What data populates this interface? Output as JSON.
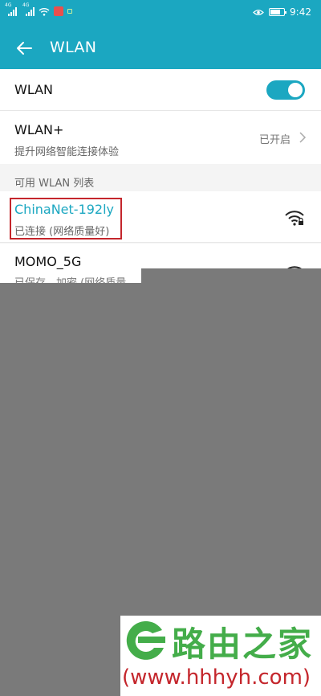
{
  "status_bar": {
    "signal1_label": "4G",
    "signal2_label": "4G",
    "time": "9:42"
  },
  "app_bar": {
    "title": "WLAN"
  },
  "wlan_toggle": {
    "label": "WLAN",
    "enabled": true
  },
  "wlan_plus": {
    "label": "WLAN+",
    "subtitle": "提升网络智能连接体验",
    "value": "已开启"
  },
  "section": {
    "title": "可用 WLAN 列表"
  },
  "networks": [
    {
      "name": "ChinaNet-192ly",
      "status": "已连接 (网络质量好)",
      "secured": true
    },
    {
      "name": "MOMO_5G",
      "status": "已保存，加密 (网络质量",
      "secured": true
    }
  ],
  "watermark": {
    "text": "路由之家",
    "url": "(www.hhhyh.com)"
  },
  "colors": {
    "accent": "#1ba7c1",
    "highlight": "#c4262c",
    "watermark_green": "#44ad4a",
    "overlay_gray": "#7a7a7a"
  }
}
